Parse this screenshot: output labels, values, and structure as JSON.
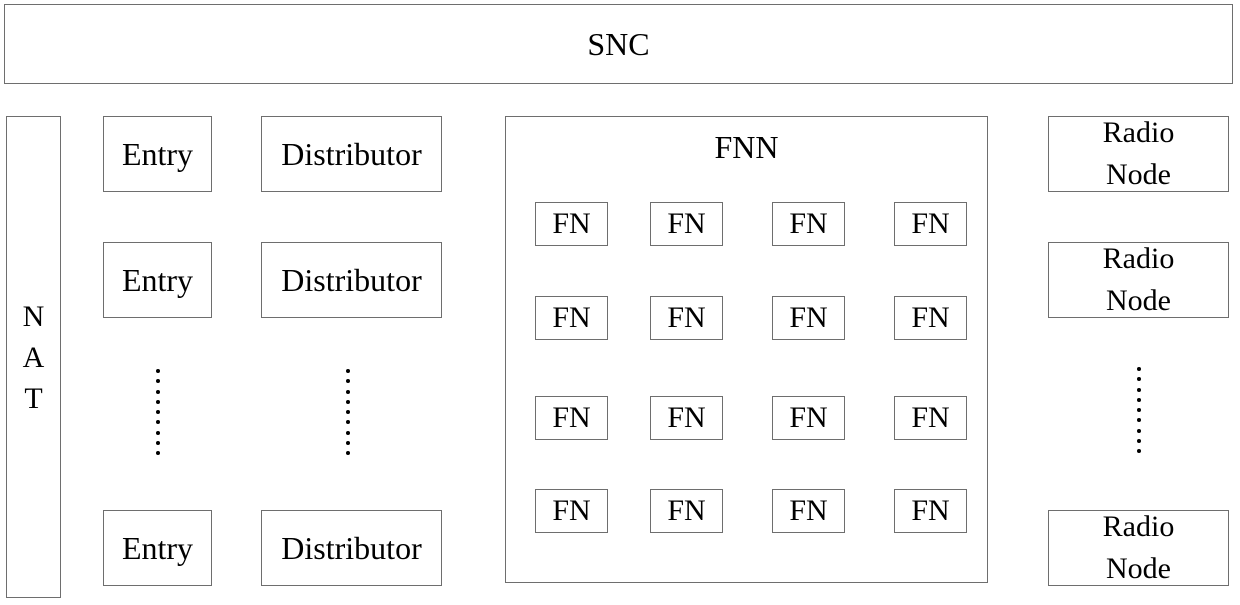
{
  "diagram": {
    "snc": {
      "label": "SNC"
    },
    "nat": {
      "letters": [
        "N",
        "A",
        "T"
      ]
    },
    "entries": [
      {
        "label": "Entry"
      },
      {
        "label": "Entry"
      },
      {
        "label": "Entry"
      }
    ],
    "distributors": [
      {
        "label": "Distributor"
      },
      {
        "label": "Distributor"
      },
      {
        "label": "Distributor"
      }
    ],
    "ellipsis": {
      "entries": "vertical-dots",
      "distributors": "vertical-dots",
      "radio_nodes": "vertical-dots"
    },
    "fnn": {
      "title": "FNN",
      "grid_rows": 4,
      "grid_cols": 4,
      "nodes": [
        "FN",
        "FN",
        "FN",
        "FN",
        "FN",
        "FN",
        "FN",
        "FN",
        "FN",
        "FN",
        "FN",
        "FN",
        "FN",
        "FN",
        "FN",
        "FN"
      ]
    },
    "radio_nodes": [
      {
        "line1": "Radio",
        "line2": "Node"
      },
      {
        "line1": "Radio",
        "line2": "Node"
      },
      {
        "line1": "Radio",
        "line2": "Node"
      }
    ]
  }
}
